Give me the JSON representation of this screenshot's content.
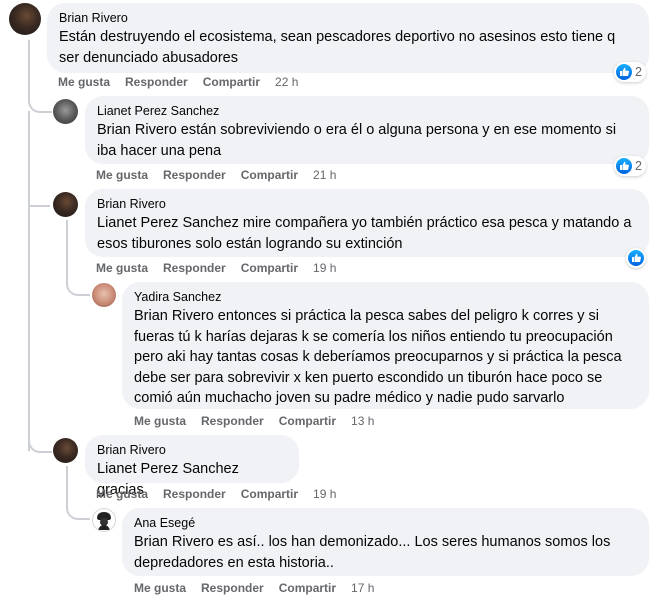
{
  "comments": [
    {
      "author": "Brian Rivero",
      "mention": "",
      "text": "Están destruyendo el ecosistema, sean pescadores deportivo no asesinos esto tiene q ser denunciado abusadores",
      "like": "Me gusta",
      "reply": "Responder",
      "share": "Compartir",
      "time": "22 h",
      "reactions": "2"
    },
    {
      "author": "Lianet Perez Sanchez",
      "mention": "Brian Rivero",
      "text": " están sobreviviendo o era él o alguna persona y en ese momento si iba hacer una pena",
      "like": "Me gusta",
      "reply": "Responder",
      "share": "Compartir",
      "time": "21 h",
      "reactions": "2"
    },
    {
      "author": "Brian Rivero",
      "mention": "Lianet Perez Sanchez",
      "text": " mire compañera yo también práctico esa pesca y matando a esos tiburones solo están logrando su extinción",
      "like": "Me gusta",
      "reply": "Responder",
      "share": "Compartir",
      "time": "19 h",
      "reactions": ""
    },
    {
      "author": "Yadira Sanchez",
      "mention": "Brian Rivero",
      "text": " entonces si práctica la pesca sabes del peligro k corres y si fueras tú k harías dejaras k se comería los niños entiendo tu preocupación pero aki hay tantas cosas k deberíamos preocuparnos y si práctica la pesca debe ser para sobrevivir x ken puerto escondido un tiburón hace poco se comió aún muchacho joven su padre médico y nadie pudo sarvarlo",
      "like": "Me gusta",
      "reply": "Responder",
      "share": "Compartir",
      "time": "13 h"
    },
    {
      "author": "Brian Rivero",
      "mention": "Lianet Perez Sanchez",
      "text": " gracias",
      "like": "Me gusta",
      "reply": "Responder",
      "share": "Compartir",
      "time": "19 h"
    },
    {
      "author": "Ana Esegé",
      "mention": "Brian Rivero",
      "text": " es así.. los han demonizado... Los seres humanos somos los depredadores en esta historia..",
      "like": "Me gusta",
      "reply": "Responder",
      "share": "Compartir",
      "time": "17 h"
    }
  ],
  "colors": {
    "bubble": "#f0f2f5",
    "meta": "#65676b",
    "like_blue": "#1877f2"
  }
}
